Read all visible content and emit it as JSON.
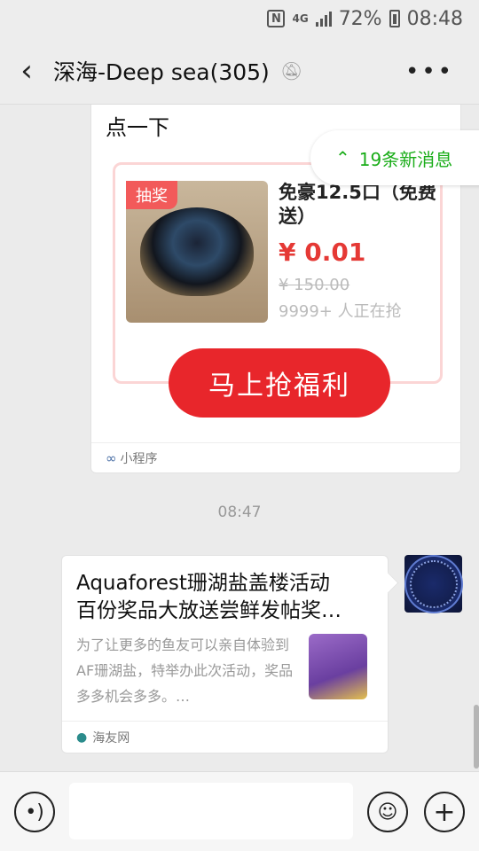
{
  "status_bar": {
    "nfc": "N",
    "network": "4G",
    "battery_percent": "72%",
    "clock": "08:48"
  },
  "header": {
    "title": "深海-Deep sea(305)",
    "back_icon": "chevron-left-icon",
    "mute_icon": "bell-off-icon",
    "more_icon": "more-dots-icon"
  },
  "messages": {
    "card1": {
      "partial_text": "点一下",
      "badge": "抽奖",
      "product_name": "免豪12.5口（免费送）",
      "price": "¥ 0.01",
      "original_price": "¥ 150.00",
      "participants": "9999+ 人正在抢",
      "cta": "马上抢福利",
      "footer_label": "小程序"
    },
    "new_message_banner": {
      "text": "19条新消息",
      "icon": "double-chevron-up-icon"
    },
    "timestamp": "08:47",
    "card2": {
      "title_line1": "Aquaforest珊湖盐盖楼活动",
      "title_line2": "百份奖品大放送尝鲜发帖奖…",
      "description": "为了让更多的鱼友可以亲自体验到AF珊湖盐，特举办此次活动，奖品多多机会多多。…",
      "source": "海友网"
    }
  },
  "input_bar": {
    "voice_icon": "voice-icon",
    "emoji_icon": "emoji-icon",
    "plus_icon": "plus-icon",
    "input_value": ""
  },
  "colors": {
    "accent_green": "#1aad19",
    "price_red": "#e53935",
    "cta_red": "#e8262b"
  }
}
